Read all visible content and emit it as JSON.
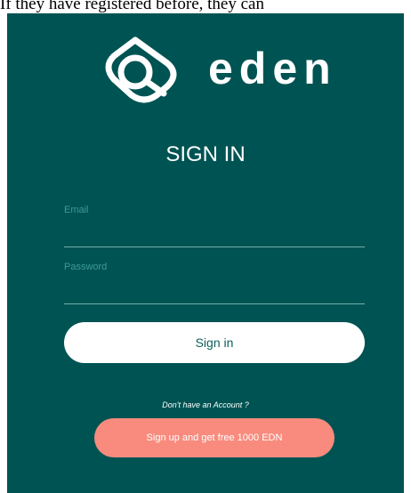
{
  "caption": "If they have registered before, they can",
  "brand": {
    "name": "eden",
    "logo_icon": "eden-logo-icon"
  },
  "form": {
    "title": "SIGN IN",
    "email_label": "Email",
    "email_value": "",
    "password_label": "Password",
    "password_value": "",
    "signin_label": "Sign in",
    "no_account_text": "Don't have an Account ?",
    "signup_label": "Sign up and get free 1000 EDN"
  },
  "colors": {
    "panel": "#005353",
    "signin_button": "#ffffff",
    "signup_button": "#f88b7d",
    "field_label": "#3f9a96"
  }
}
